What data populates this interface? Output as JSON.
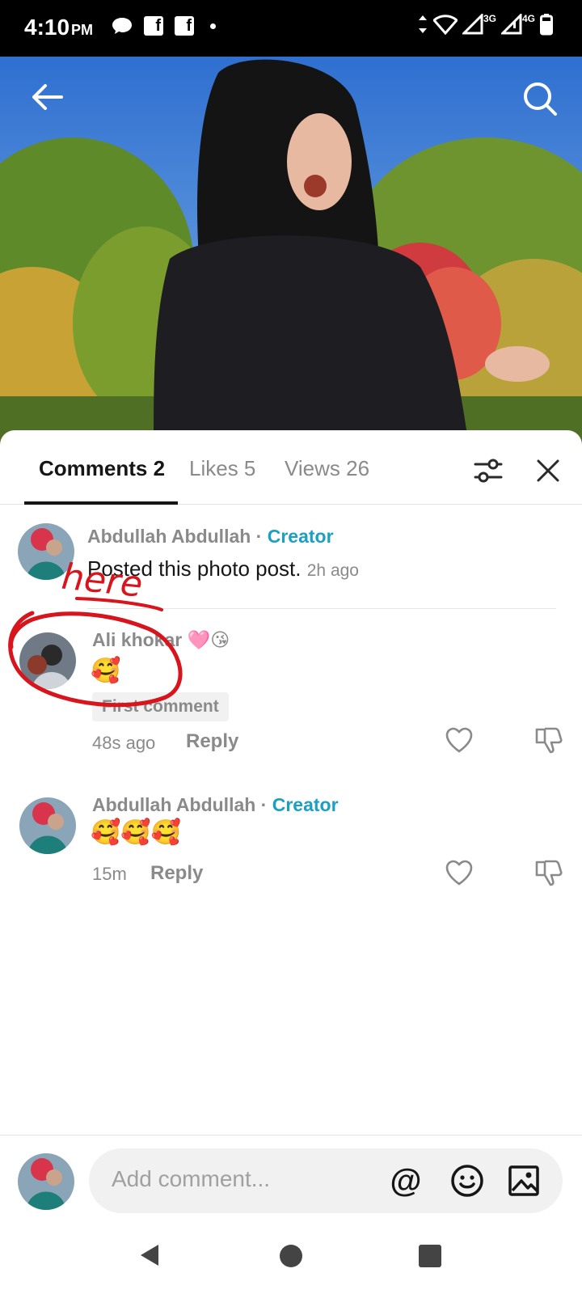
{
  "status_bar": {
    "time": "4:10",
    "ampm": "PM",
    "fb1": "f",
    "fb2": "f",
    "net1": "3G",
    "net2": "4G"
  },
  "tabs": {
    "comments": "Comments 2",
    "likes": "Likes 5",
    "views": "Views 26"
  },
  "post": {
    "author": "Abdullah Abdullah",
    "separator": " · ",
    "badge": "Creator",
    "text": "Posted this photo post.",
    "time": "2h ago"
  },
  "comments": [
    {
      "author": "Ali khokar",
      "author_emoji": "🩷😘",
      "text": "🥰",
      "chip": "First comment",
      "time": "48s ago",
      "reply": "Reply"
    },
    {
      "author": "Abdullah Abdullah",
      "separator": " · ",
      "badge": "Creator",
      "text": "🥰🥰🥰",
      "time": "15m",
      "reply": "Reply"
    }
  ],
  "annotation_text": "here",
  "input": {
    "placeholder": "Add comment...",
    "at": "@"
  },
  "colors": {
    "accent": "#1aa0c4",
    "annotation": "#d8141c"
  }
}
